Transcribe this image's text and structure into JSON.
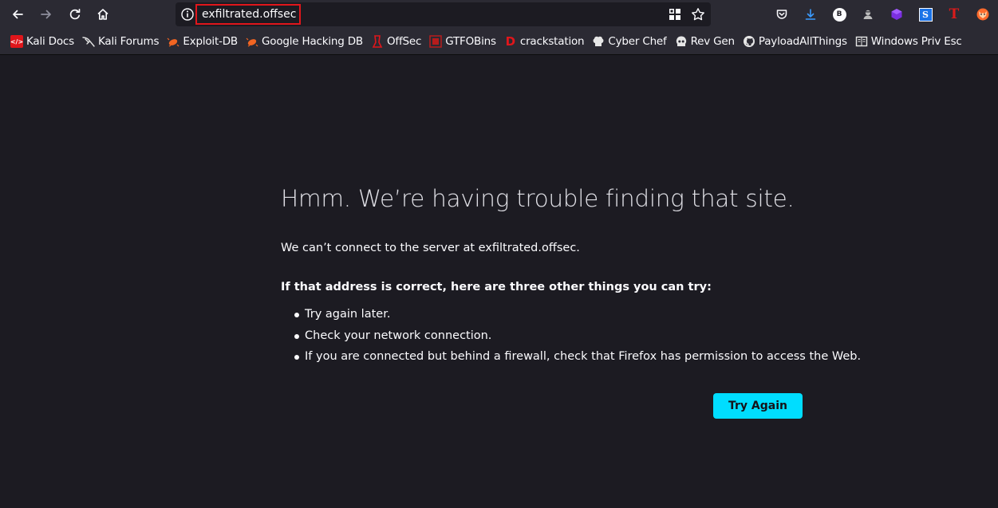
{
  "browser": {
    "url": "exfiltrated.offsec",
    "toolbar_icons": [
      "back-icon",
      "forward-icon",
      "reload-icon",
      "home-icon"
    ],
    "url_bar_icons": [
      "info-icon",
      "qr-grid-icon",
      "bookmark-star-icon"
    ],
    "extensions": [
      {
        "icon": "pocket-icon",
        "color": "#fbfbfe"
      },
      {
        "icon": "download-icon",
        "color": "#3a9bff"
      },
      {
        "icon": "badge-b-icon",
        "label": "B",
        "color": "#ffffff"
      },
      {
        "icon": "spy-icon",
        "color": "#cccccc"
      },
      {
        "icon": "cube-icon",
        "color": "#8a2be2"
      },
      {
        "icon": "s-square-icon",
        "label": "S",
        "color": "#1a73e8"
      },
      {
        "icon": "red-t-icon",
        "label": "T",
        "color": "#d81b1b"
      },
      {
        "icon": "fox-icon",
        "color": "#ff6a2c"
      }
    ]
  },
  "bookmarks": [
    {
      "label": "Kali Docs",
      "icon": "kali-docs-icon",
      "color": "#e0161b"
    },
    {
      "label": "Kali Forums",
      "icon": "kali-dragon-icon",
      "color": "#e6e6e6"
    },
    {
      "label": "Exploit-DB",
      "icon": "exploitdb-bug-icon",
      "color": "#f26522"
    },
    {
      "label": "Google Hacking DB",
      "icon": "ghdb-bug-icon",
      "color": "#f26522"
    },
    {
      "label": "OffSec",
      "icon": "offsec-icon",
      "color": "#e0161b"
    },
    {
      "label": "GTFOBins",
      "icon": "gtfobins-icon",
      "color": "#b71c1c"
    },
    {
      "label": "crackstation",
      "icon": "crackstation-icon",
      "color": "#e0161b"
    },
    {
      "label": "Cyber Chef",
      "icon": "chef-hat-icon",
      "color": "#e6e6e6"
    },
    {
      "label": "Rev Gen",
      "icon": "skull-icon",
      "color": "#e6e6e6"
    },
    {
      "label": "PayloadAllThings",
      "icon": "github-icon",
      "color": "#e6e6e6"
    },
    {
      "label": "Windows Priv Esc",
      "icon": "book-icon",
      "color": "#e6e6e6"
    }
  ],
  "error_page": {
    "title": "Hmm. We’re having trouble finding that site.",
    "message": "We can’t connect to the server at exfiltrated.offsec.",
    "suggestion_heading": "If that address is correct, here are three other things you can try:",
    "suggestions": [
      "Try again later.",
      "Check your network connection.",
      "If you are connected but behind a firewall, check that Firefox has permission to access the Web."
    ],
    "try_again_label": "Try Again"
  }
}
